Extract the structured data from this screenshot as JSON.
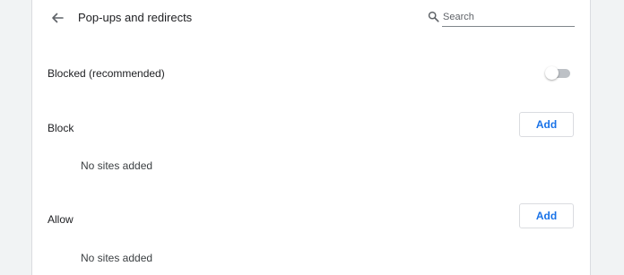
{
  "header": {
    "title": "Pop-ups and redirects",
    "back_icon": "arrow-back-icon",
    "search": {
      "placeholder": "Search",
      "value": "",
      "icon": "search-icon"
    }
  },
  "blocked_setting": {
    "label": "Blocked (recommended)",
    "toggle_on": false
  },
  "block_section": {
    "title": "Block",
    "add_label": "Add",
    "empty_text": "No sites added"
  },
  "allow_section": {
    "title": "Allow",
    "add_label": "Add",
    "empty_text": "No sites added"
  },
  "colors": {
    "accent": "#1a73e8",
    "toggle_off_track": "#bdc1c6",
    "background": "#f1f3f4"
  }
}
